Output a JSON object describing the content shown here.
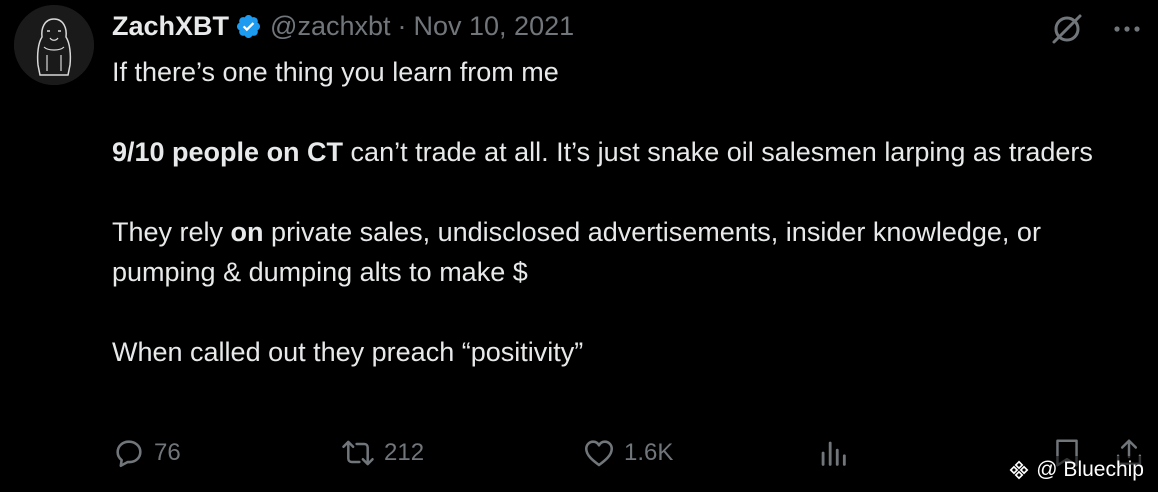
{
  "author": {
    "name": "ZachXBT",
    "handle": "@zachxbt",
    "separator": "·",
    "date": "Nov 10, 2021",
    "verified_color": "#1d9bf0"
  },
  "tweet": {
    "line1": "If there’s one thing you learn from me",
    "p2_bold": "9/10 people on CT",
    "p2_rest": " can’t trade at all. It’s just snake oil salesmen larping as traders",
    "p3_start": "They rely ",
    "p3_bold": "on",
    "p3_rest": " private sales, undisclosed advertisements, insider knowledge, or pumping & dumping alts to make $",
    "p4": "When called out they preach “positivity”"
  },
  "actions": {
    "reply_count": "76",
    "retweet_count": "212",
    "like_count": "1.6K"
  },
  "watermark": {
    "text": "@ Bluechip"
  },
  "icons": [
    "grok-icon",
    "more-icon",
    "reply-icon",
    "retweet-icon",
    "like-icon",
    "views-icon",
    "bookmark-icon",
    "share-icon",
    "binance-logo-icon",
    "verified-badge-icon"
  ],
  "colors": {
    "background": "#000000",
    "text": "#e7e9ea",
    "muted": "#71767b",
    "verified": "#1d9bf0"
  }
}
